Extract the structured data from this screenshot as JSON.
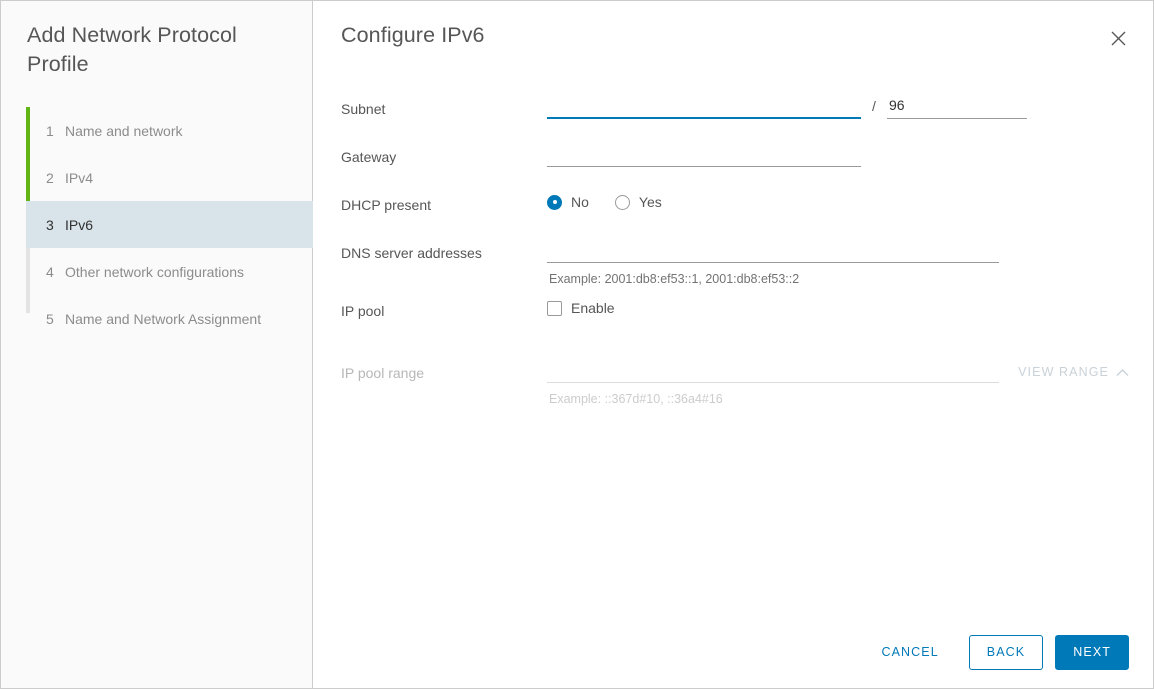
{
  "sidebar": {
    "title": "Add Network Protocol Profile",
    "steps": [
      {
        "num": "1",
        "label": "Name and network",
        "state": "complete"
      },
      {
        "num": "2",
        "label": "IPv4",
        "state": "complete"
      },
      {
        "num": "3",
        "label": "IPv6",
        "state": "active"
      },
      {
        "num": "4",
        "label": "Other network configurations",
        "state": "pending"
      },
      {
        "num": "5",
        "label": "Name and Network Assignment",
        "state": "pending"
      }
    ]
  },
  "header": {
    "title": "Configure IPv6",
    "close_icon": "close-icon"
  },
  "form": {
    "subnet": {
      "label": "Subnet",
      "value": "",
      "placeholder": "",
      "focused": true,
      "separator": "/",
      "prefix_value": "96",
      "prefix_placeholder": ""
    },
    "gateway": {
      "label": "Gateway",
      "value": "",
      "placeholder": ""
    },
    "dhcp_present": {
      "label": "DHCP present",
      "options": [
        {
          "label": "No",
          "selected": true
        },
        {
          "label": "Yes",
          "selected": false
        }
      ]
    },
    "dns_servers": {
      "label": "DNS server addresses",
      "value": "",
      "placeholder": "",
      "example": "Example: 2001:db8:ef53::1, 2001:db8:ef53::2"
    },
    "ip_pool": {
      "label": "IP pool",
      "checkbox_label": "Enable",
      "checked": false
    },
    "ip_pool_range": {
      "label": "IP pool range",
      "value": "",
      "placeholder": "",
      "disabled": true,
      "example": "Example: ::367d#10, ::36a4#16",
      "view_range_label": "VIEW RANGE",
      "view_range_icon": "chevron-up-icon"
    }
  },
  "footer": {
    "cancel_label": "CANCEL",
    "back_label": "BACK",
    "next_label": "NEXT"
  },
  "colors": {
    "accent": "#0079b8",
    "progress_complete": "#60b515",
    "active_step_bg": "#d9e4ea"
  }
}
